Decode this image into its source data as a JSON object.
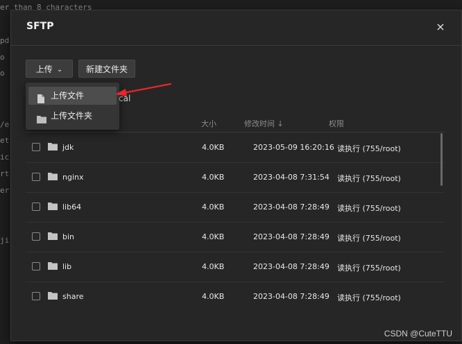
{
  "background_terminal": {
    "lines": [
      "er than 8 characters",
      "pd",
      "o",
      "o",
      "/e",
      "et",
      "ic",
      "rt",
      "er",
      "ji"
    ]
  },
  "dialog": {
    "title": "SFTP",
    "close_glyph": "×"
  },
  "toolbar": {
    "upload_label": "上传",
    "upload_chevron": "⌄",
    "new_folder_label": "新建文件夹"
  },
  "upload_menu": {
    "items": [
      {
        "label": "上传文件",
        "icon": "file-icon",
        "highlighted": true
      },
      {
        "label": "上传文件夹",
        "icon": "folder-icon",
        "highlighted": false
      }
    ]
  },
  "path_partial": "cal",
  "table": {
    "columns": {
      "size": "大小",
      "mtime": "修改时间 ↓",
      "perm": "权限"
    },
    "rows": [
      {
        "name": "jdk",
        "size": "4.0KB",
        "mtime": "2023-05-09 16:20:16",
        "perm": "读执行 (755/root)"
      },
      {
        "name": "nginx",
        "size": "4.0KB",
        "mtime": "2023-04-08 7:31:54",
        "perm": "读执行 (755/root)"
      },
      {
        "name": "lib64",
        "size": "4.0KB",
        "mtime": "2023-04-08 7:28:49",
        "perm": "读执行 (755/root)"
      },
      {
        "name": "bin",
        "size": "4.0KB",
        "mtime": "2023-04-08 7:28:49",
        "perm": "读执行 (755/root)"
      },
      {
        "name": "lib",
        "size": "4.0KB",
        "mtime": "2023-04-08 7:28:49",
        "perm": "读执行 (755/root)"
      },
      {
        "name": "share",
        "size": "4.0KB",
        "mtime": "2023-04-08 7:28:49",
        "perm": "读执行 (755/root)"
      }
    ]
  },
  "annotation_color": "#e8262b",
  "watermark": "CSDN @CuteTTU"
}
